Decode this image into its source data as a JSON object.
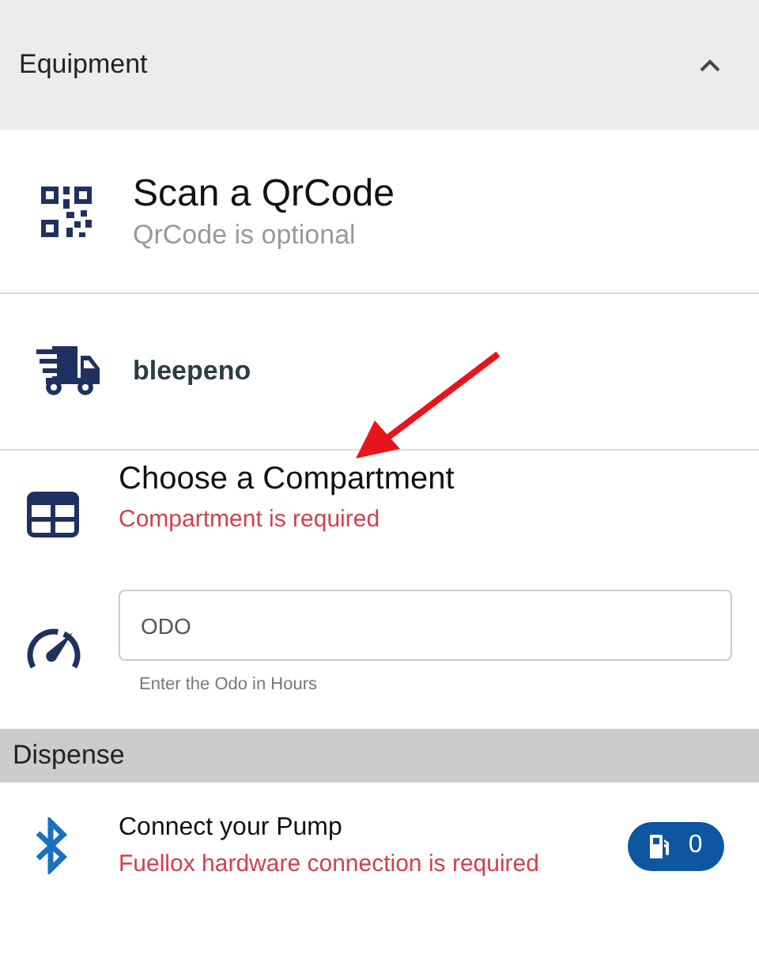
{
  "equipment": {
    "title": "Equipment",
    "expanded": true
  },
  "qr": {
    "title": "Scan a QrCode",
    "subtitle": "QrCode is optional"
  },
  "vehicle": {
    "name": "bleepeno"
  },
  "compartment": {
    "title": "Choose a Compartment",
    "error": "Compartment is required"
  },
  "odo": {
    "placeholder": "ODO",
    "hint": "Enter the Odo in Hours"
  },
  "dispense": {
    "title": "Dispense"
  },
  "pump": {
    "title": "Connect your Pump",
    "error": "Fuellox hardware connection is required",
    "count": "0"
  }
}
